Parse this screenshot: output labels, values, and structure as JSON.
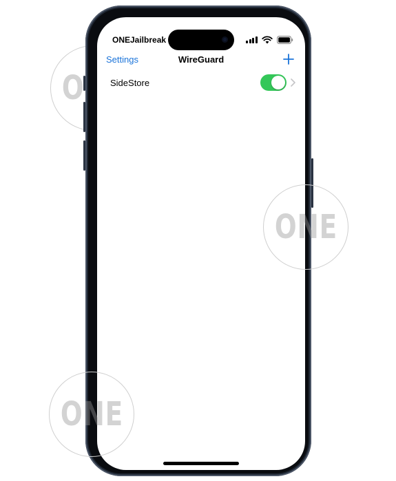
{
  "status_bar": {
    "carrier": "ONEJailbreak",
    "icons": [
      "cellular-signal-icon",
      "wifi-icon",
      "battery-icon"
    ]
  },
  "nav": {
    "back_label": "Settings",
    "title": "WireGuard",
    "add_icon": "plus-icon"
  },
  "tunnels": [
    {
      "name": "SideStore",
      "active": true
    }
  ],
  "watermark": {
    "text": "ONE"
  },
  "colors": {
    "accent": "#1a73d9",
    "toggle_on": "#34c759",
    "frame": "#1f2733"
  }
}
